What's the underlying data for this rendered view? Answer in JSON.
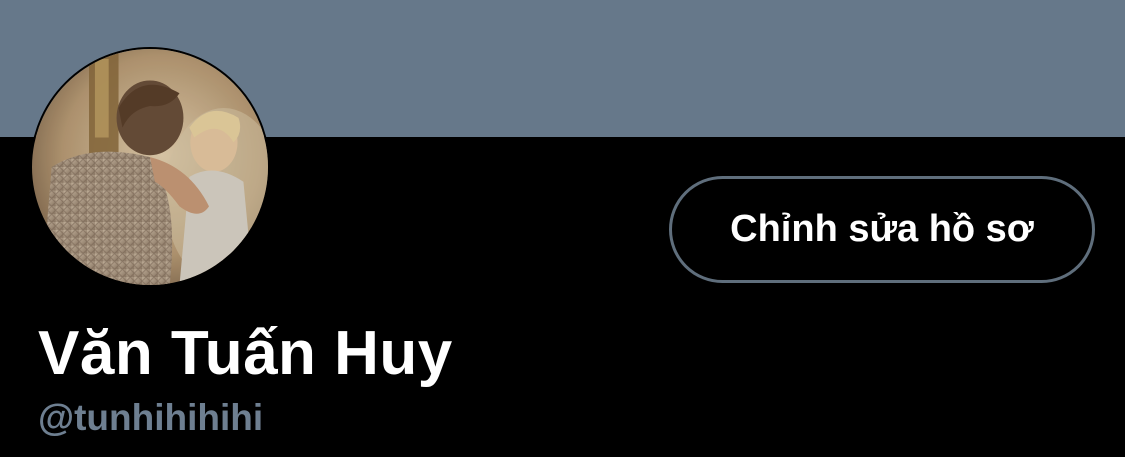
{
  "profile": {
    "display_name": "Văn Tuấn Huy",
    "handle": "@tunhihihihi",
    "edit_button_label": "Chỉnh sửa hồ sơ"
  },
  "colors": {
    "banner": "#66788a",
    "background": "#000000",
    "button_border": "#5f6e7c",
    "handle_text": "#6e7f91",
    "primary_text": "#ffffff"
  }
}
